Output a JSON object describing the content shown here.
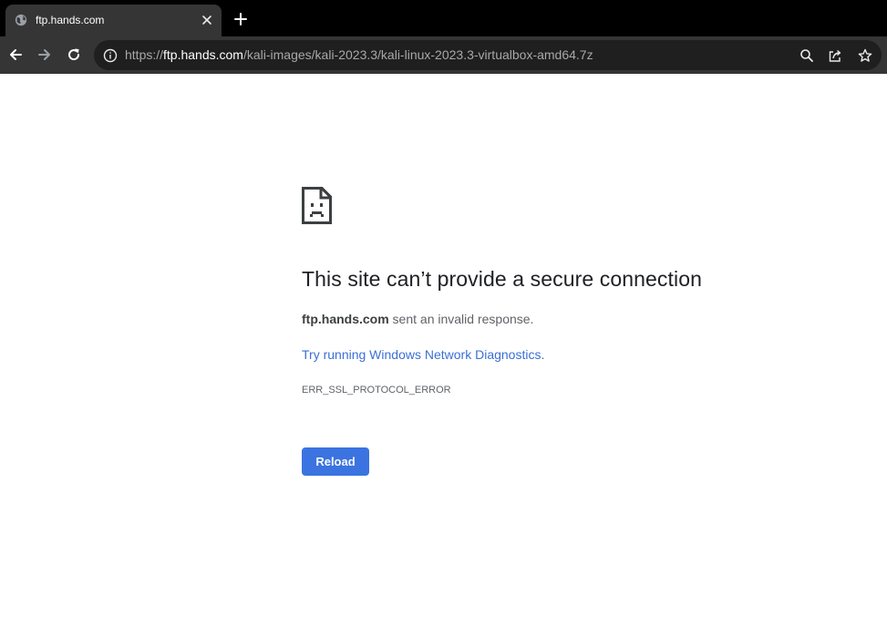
{
  "tab": {
    "title": "ftp.hands.com",
    "favicon": "globe-icon",
    "close_icon": "close-icon"
  },
  "new_tab_icon": "plus-icon",
  "toolbar": {
    "back_icon": "arrow-left-icon",
    "forward_icon": "arrow-right-icon",
    "reload_icon": "reload-icon",
    "info_icon": "info-icon",
    "url_scheme": "https://",
    "url_host": "ftp.hands.com",
    "url_path": "/kali-images/kali-2023.3/kali-linux-2023.3-virtualbox-amd64.7z",
    "zoom_icon": "search-icon",
    "share_icon": "share-icon",
    "bookmark_icon": "star-icon"
  },
  "error": {
    "icon": "sad-page-icon",
    "heading": "This site can’t provide a secure connection",
    "host": "ftp.hands.com",
    "summary_suffix": " sent an invalid response.",
    "diagnostics_link": "Try running Windows Network Diagnostics",
    "diagnostics_end": ".",
    "code": "ERR_SSL_PROTOCOL_ERROR",
    "reload_label": "Reload"
  },
  "colors": {
    "tabstrip": "#000000",
    "toolbar": "#353535",
    "omnibox": "#1f1f1f",
    "link": "#3b6fd6",
    "button": "#3b73e0"
  }
}
